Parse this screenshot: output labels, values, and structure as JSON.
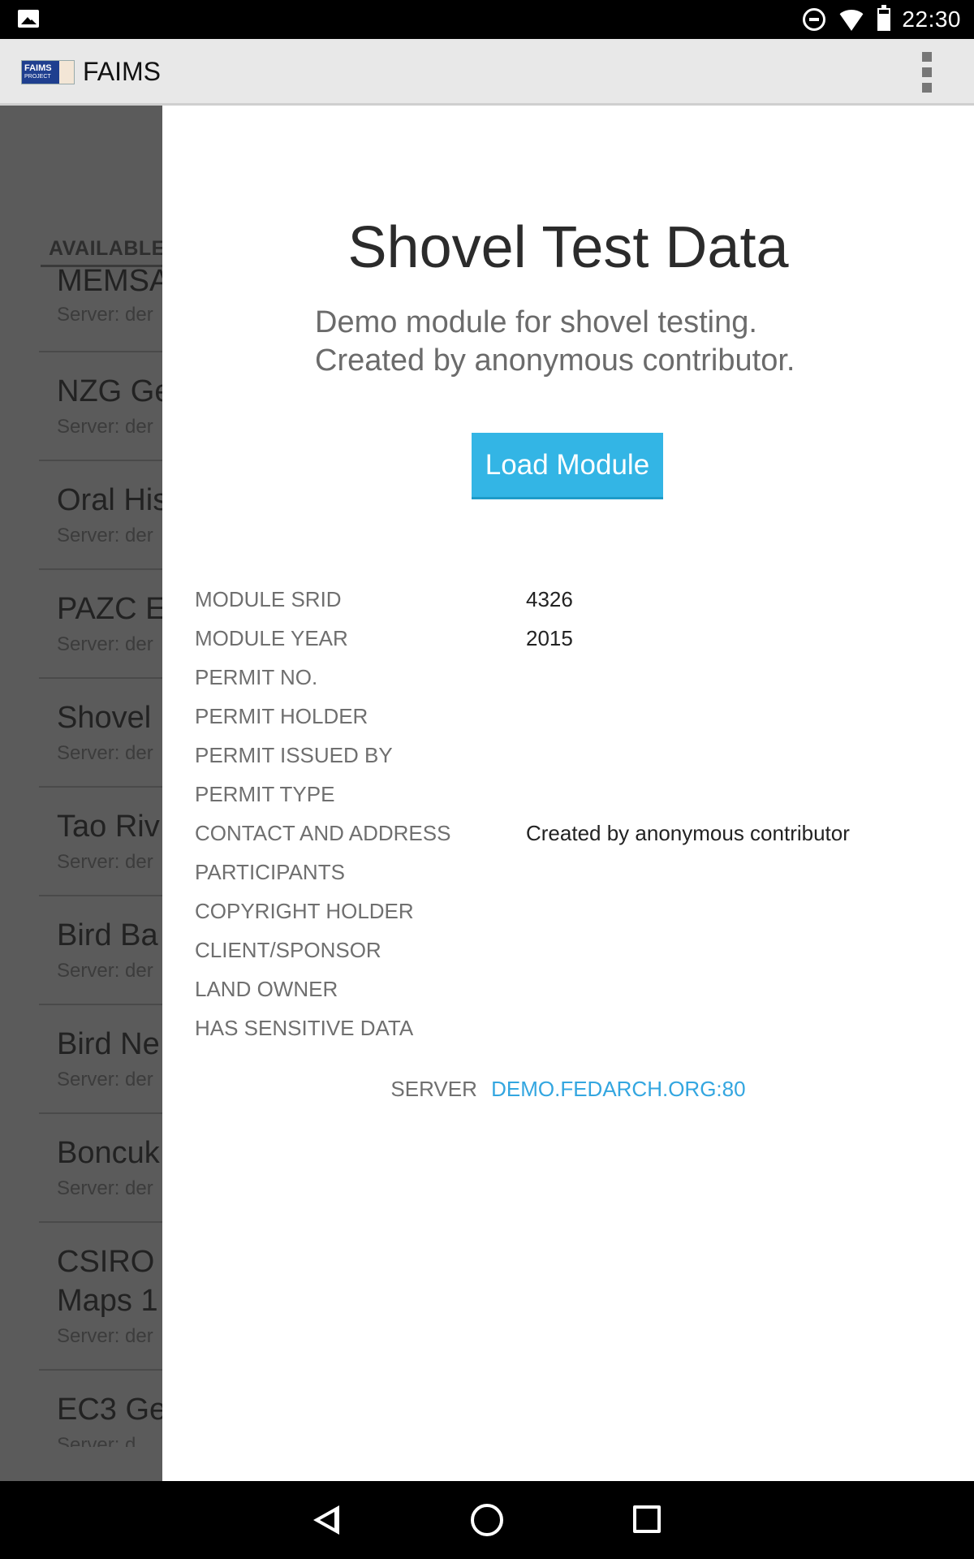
{
  "status_bar": {
    "time": "22:30",
    "icons": [
      "gallery-icon",
      "do-not-disturb-icon",
      "wifi-icon",
      "battery-icon"
    ]
  },
  "action_bar": {
    "logo_text": "FAIMS",
    "logo_subtext": "PROJECT",
    "title": "FAIMS",
    "overflow_icon": "overflow-menu-icon"
  },
  "module_list": {
    "header": "AVAILABLE",
    "items": [
      {
        "name": "MEMSA",
        "server": "Server: der"
      },
      {
        "name": "NZG Ge",
        "server": "Server: der"
      },
      {
        "name": "Oral His",
        "server": "Server: der"
      },
      {
        "name": "PAZC E",
        "server": "Server: der"
      },
      {
        "name": "Shovel",
        "server": "Server: der"
      },
      {
        "name": "Tao Riv",
        "server": "Server: der"
      },
      {
        "name": "Bird Ba",
        "server": "Server: der"
      },
      {
        "name": "Bird Ne",
        "server": "Server: der"
      },
      {
        "name": "Boncuk",
        "server": "Server: der"
      },
      {
        "name": "CSIRO (",
        "name2": "Maps 1",
        "server": "Server: der"
      },
      {
        "name": "EC3 Ge",
        "server": "Server: d"
      }
    ]
  },
  "dialog": {
    "title": "Shovel Test Data",
    "description_line1": "Demo module for shovel testing.",
    "description_line2": "Created by anonymous contributor.",
    "load_button": "Load Module",
    "details": [
      {
        "label": "MODULE SRID",
        "value": "4326"
      },
      {
        "label": "MODULE YEAR",
        "value": "2015"
      },
      {
        "label": "PERMIT NO.",
        "value": ""
      },
      {
        "label": "PERMIT HOLDER",
        "value": ""
      },
      {
        "label": "PERMIT ISSUED BY",
        "value": ""
      },
      {
        "label": "PERMIT TYPE",
        "value": ""
      },
      {
        "label": "CONTACT AND ADDRESS",
        "value": "Created by anonymous contributor"
      },
      {
        "label": "PARTICIPANTS",
        "value": ""
      },
      {
        "label": "COPYRIGHT HOLDER",
        "value": ""
      },
      {
        "label": "CLIENT/SPONSOR",
        "value": ""
      },
      {
        "label": "LAND OWNER",
        "value": ""
      },
      {
        "label": "HAS SENSITIVE DATA",
        "value": ""
      }
    ],
    "server_label": "SERVER",
    "server_value": "DEMO.FEDARCH.ORG:80"
  },
  "nav_bar": {
    "icons": [
      "back-icon",
      "home-icon",
      "recents-icon"
    ]
  }
}
